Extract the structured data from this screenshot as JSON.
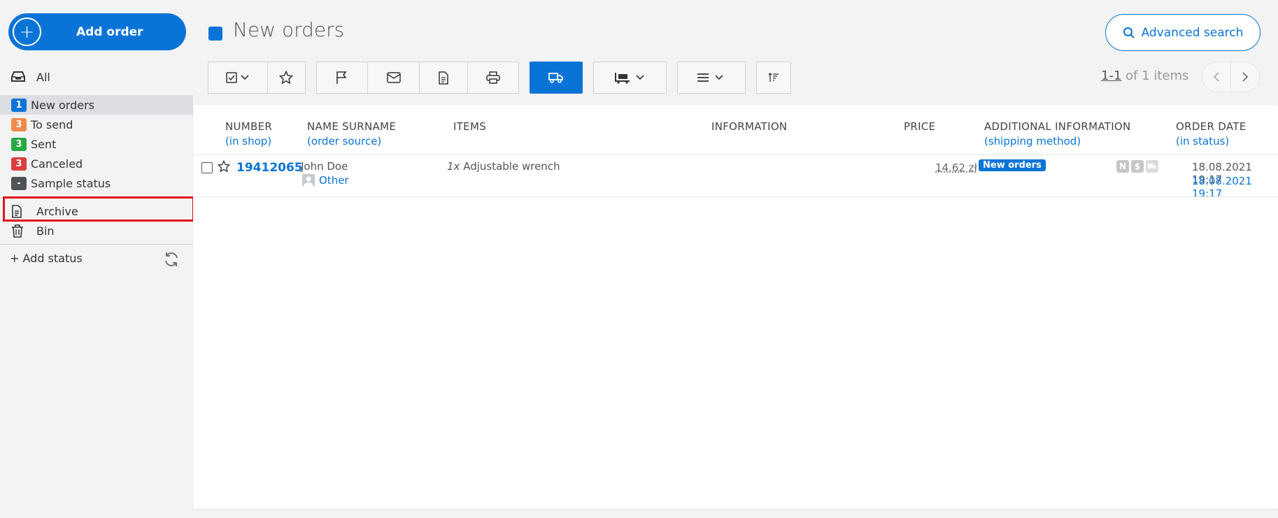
{
  "sidebar": {
    "add_order_label": "Add order",
    "all_label": "All",
    "statuses": [
      {
        "count": "1",
        "label": "New orders",
        "color": "#0a74d6",
        "active": true
      },
      {
        "count": "3",
        "label": "To send",
        "color": "#ef8a4b",
        "active": false
      },
      {
        "count": "3",
        "label": "Sent",
        "color": "#28a745",
        "active": false
      },
      {
        "count": "3",
        "label": "Canceled",
        "color": "#dc3d3d",
        "active": false
      },
      {
        "count": "-",
        "label": "Sample status",
        "color": "#4f5258",
        "active": false
      }
    ],
    "archive_label": "Archive",
    "bin_label": "Bin",
    "add_status_label": "+ Add status"
  },
  "header": {
    "title": "New orders",
    "title_color": "#0a74d6",
    "advanced_search_label": "Advanced search"
  },
  "pager": {
    "range": "1-1",
    "suffix": " of 1 items"
  },
  "table": {
    "columns": [
      {
        "main": "NUMBER",
        "sub": "(in shop)"
      },
      {
        "main": "NAME SURNAME",
        "sub": "(order source)"
      },
      {
        "main": "ITEMS",
        "sub": ""
      },
      {
        "main": "INFORMATION",
        "sub": ""
      },
      {
        "main": "PRICE",
        "sub": ""
      },
      {
        "main": "ADDITIONAL INFORMATION",
        "sub": "(shipping method)"
      },
      {
        "main": "ORDER DATE",
        "sub": "(in status)"
      }
    ],
    "rows": [
      {
        "number": "19412065",
        "name": "John Doe",
        "source": "Other",
        "item_qty": "1x",
        "item_name": " Adjustable wrench",
        "price": "14.62 zł",
        "status": "New orders",
        "flags": [
          "N",
          "$"
        ],
        "order_date": "18.08.2021 19:17",
        "status_date": "18.08.2021 19:17"
      }
    ]
  }
}
